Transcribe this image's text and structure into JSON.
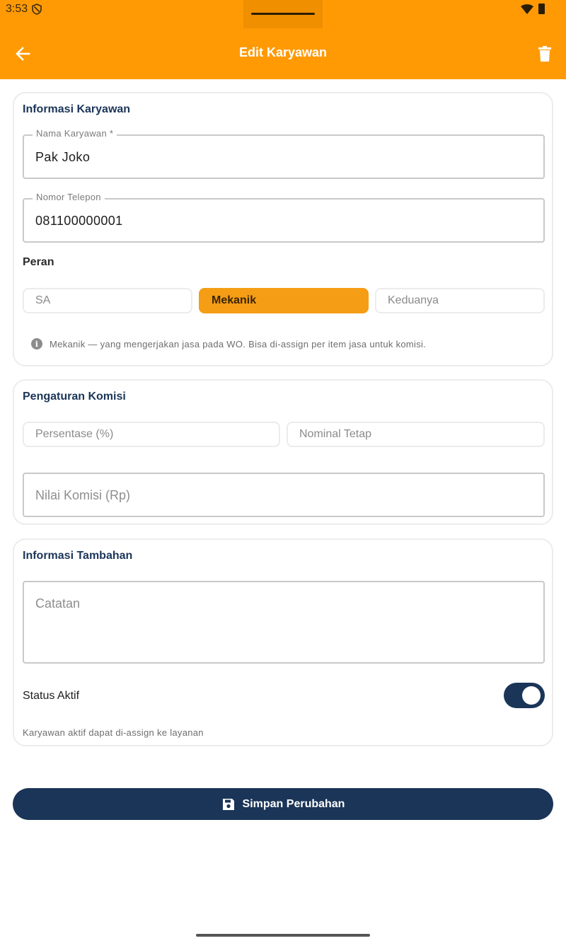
{
  "status_bar": {
    "time": "3:53"
  },
  "app_bar": {
    "title": "Edit Karyawan"
  },
  "employee_info": {
    "title": "Informasi Karyawan",
    "name_field": {
      "label": "Nama Karyawan *",
      "value": "Pak Joko"
    },
    "phone_field": {
      "label": "Nomor Telepon",
      "value": "081100000001"
    },
    "role": {
      "label": "Peran",
      "options": [
        "SA",
        "Mekanik",
        "Keduanya"
      ],
      "selected": "Mekanik",
      "hint": "Mekanik — yang mengerjakan jasa pada WO. Bisa di-assign per item jasa untuk komisi."
    }
  },
  "commission": {
    "title": "Pengaturan Komisi",
    "options": [
      "Persentase (%)",
      "Nominal Tetap"
    ],
    "value_field": {
      "placeholder": "Nilai Komisi (Rp)"
    }
  },
  "extra_info": {
    "title": "Informasi Tambahan",
    "notes_field": {
      "placeholder": "Catatan"
    },
    "status": {
      "label": "Status Aktif",
      "enabled": true,
      "hint": "Karyawan aktif dapat di-assign ke layanan"
    }
  },
  "save_button": {
    "label": "Simpan Perubahan"
  },
  "colors": {
    "primary": "#1b3558",
    "accent": "#ff9a05",
    "selected_chip": "#f59d15"
  }
}
